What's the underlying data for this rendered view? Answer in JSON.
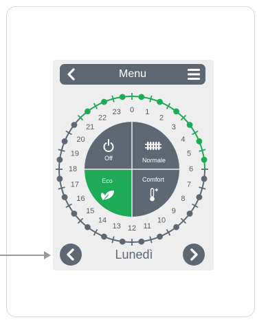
{
  "header": {
    "title": "Menu"
  },
  "modes": {
    "off": "Off",
    "normale": "Normale",
    "eco": "Eco",
    "comfort": "Comfort"
  },
  "schedule": {
    "hours": [
      "0",
      "1",
      "2",
      "3",
      "4",
      "5",
      "6",
      "7",
      "8",
      "9",
      "10",
      "11",
      "12",
      "13",
      "14",
      "15",
      "16",
      "17",
      "18",
      "19",
      "20",
      "21",
      "22",
      "23"
    ],
    "slot_state": [
      "eco",
      "eco",
      "eco",
      "eco",
      "eco",
      "eco",
      "eco",
      "eco",
      "eco",
      "eco",
      "eco",
      "eco",
      "comfort",
      "comfort",
      "comfort",
      "comfort",
      "comfort",
      "comfort",
      "comfort",
      "comfort",
      "comfort",
      "comfort",
      "comfort",
      "comfort",
      "comfort",
      "comfort",
      "comfort",
      "comfort",
      "comfort",
      "comfort",
      "comfort",
      "comfort",
      "comfort",
      "comfort",
      "comfort",
      "comfort",
      "comfort",
      "comfort",
      "comfort",
      "comfort",
      "comfort",
      "comfort",
      "eco",
      "eco",
      "eco",
      "eco",
      "eco",
      "eco"
    ]
  },
  "footer": {
    "day": "Lunedì"
  },
  "colors": {
    "eco": "#1eaa57",
    "comfort": "#5e6873",
    "dark": "#5e6873"
  }
}
